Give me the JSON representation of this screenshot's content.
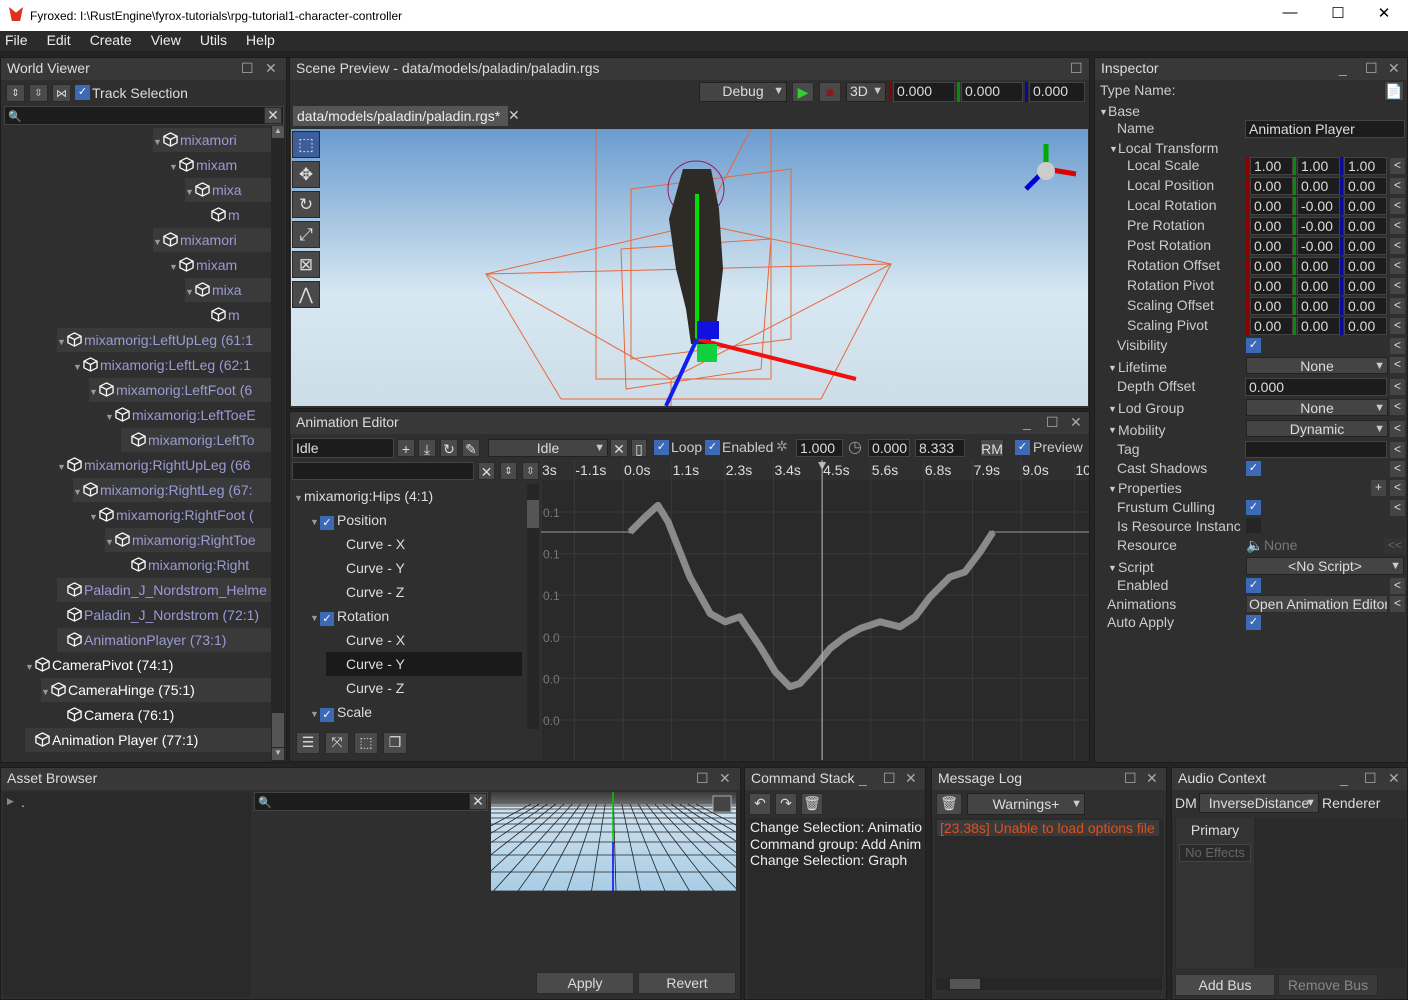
{
  "window": {
    "title": "Fyroxed: I:\\RustEngine\\fyrox-tutorials\\rpg-tutorial1-character-controller",
    "minimize": "—",
    "maximize": "☐",
    "close": "✕"
  },
  "menu": [
    "File",
    "Edit",
    "Create",
    "View",
    "Utils",
    "Help"
  ],
  "world_viewer": {
    "title": "World Viewer",
    "track_selection": "Track Selection",
    "search_placeholder": "",
    "items": [
      {
        "text": "mixamori",
        "level": 9,
        "tri": true,
        "shade": true,
        "color": "#9b9bd6"
      },
      {
        "text": "mixam",
        "level": 10,
        "tri": true,
        "shade": false,
        "color": "#9b9bd6"
      },
      {
        "text": "mixa",
        "level": 11,
        "tri": true,
        "shade": true,
        "color": "#9b9bd6"
      },
      {
        "text": "m",
        "level": 12,
        "tri": false,
        "shade": false,
        "color": "#9b9bd6"
      },
      {
        "text": "mixamori",
        "level": 9,
        "tri": true,
        "shade": true,
        "color": "#9b9bd6"
      },
      {
        "text": "mixam",
        "level": 10,
        "tri": true,
        "shade": false,
        "color": "#9b9bd6"
      },
      {
        "text": "mixa",
        "level": 11,
        "tri": true,
        "shade": true,
        "color": "#9b9bd6"
      },
      {
        "text": "m",
        "level": 12,
        "tri": false,
        "shade": false,
        "color": "#9b9bd6"
      },
      {
        "text": "mixamorig:LeftUpLeg (61:1",
        "level": 3,
        "tri": true,
        "shade": true,
        "color": "#9b9bd6"
      },
      {
        "text": "mixamorig:LeftLeg (62:1",
        "level": 4,
        "tri": true,
        "shade": false,
        "color": "#9b9bd6"
      },
      {
        "text": "mixamorig:LeftFoot (6",
        "level": 5,
        "tri": true,
        "shade": true,
        "color": "#9b9bd6"
      },
      {
        "text": "mixamorig:LeftToeE",
        "level": 6,
        "tri": true,
        "shade": false,
        "color": "#9b9bd6"
      },
      {
        "text": "mixamorig:LeftTo",
        "level": 7,
        "tri": false,
        "shade": true,
        "color": "#9b9bd6"
      },
      {
        "text": "mixamorig:RightUpLeg (66",
        "level": 3,
        "tri": true,
        "shade": false,
        "color": "#9b9bd6"
      },
      {
        "text": "mixamorig:RightLeg (67:",
        "level": 4,
        "tri": true,
        "shade": true,
        "color": "#9b9bd6"
      },
      {
        "text": "mixamorig:RightFoot (",
        "level": 5,
        "tri": true,
        "shade": false,
        "color": "#9b9bd6"
      },
      {
        "text": "mixamorig:RightToe",
        "level": 6,
        "tri": true,
        "shade": true,
        "color": "#9b9bd6"
      },
      {
        "text": "mixamorig:Right",
        "level": 7,
        "tri": false,
        "shade": false,
        "color": "#9b9bd6"
      },
      {
        "text": "Paladin_J_Nordstrom_Helme",
        "level": 3,
        "tri": false,
        "shade": true,
        "color": "#9b9bd6"
      },
      {
        "text": "Paladin_J_Nordstrom (72:1)",
        "level": 3,
        "tri": false,
        "shade": false,
        "color": "#9b9bd6"
      },
      {
        "text": "AnimationPlayer (73:1)",
        "level": 3,
        "tri": false,
        "shade": true,
        "color": "#9b9bd6"
      },
      {
        "text": "CameraPivot (74:1)",
        "level": 1,
        "tri": true,
        "shade": false,
        "color": "#ffffff"
      },
      {
        "text": "CameraHinge (75:1)",
        "level": 2,
        "tri": true,
        "shade": true,
        "color": "#ffffff"
      },
      {
        "text": "Camera (76:1)",
        "level": 3,
        "tri": false,
        "shade": false,
        "color": "#ffffff"
      },
      {
        "text": "Animation Player (77:1)",
        "level": 1,
        "tri": false,
        "shade": true,
        "color": "#ffffff"
      }
    ]
  },
  "scene_preview": {
    "title": "Scene Preview - data/models/paladin/paladin.rgs",
    "mode": "Debug",
    "view": "3D",
    "x": "0.000",
    "y": "0.000",
    "z": "0.000",
    "tab": "data/models/paladin/paladin.rgs*",
    "tools": [
      "select",
      "move",
      "rotate",
      "scale",
      "resize",
      "navmesh"
    ]
  },
  "animation_editor": {
    "title": "Animation Editor",
    "animation_name": "Idle",
    "selected_animation": "Idle",
    "loop": "Loop",
    "enabled": "Enabled",
    "speed": "1.000",
    "time_start": "0.000",
    "time_end": "8.333",
    "rm": "RM",
    "preview": "Preview",
    "tracks": [
      {
        "text": "mixamorig:Hips (4:1)",
        "level": 0,
        "tri": true,
        "check": false
      },
      {
        "text": "Position",
        "level": 1,
        "tri": true,
        "check": true
      },
      {
        "text": "Curve - X",
        "level": 2,
        "tri": false,
        "check": false
      },
      {
        "text": "Curve - Y",
        "level": 2,
        "tri": false,
        "check": false
      },
      {
        "text": "Curve - Z",
        "level": 2,
        "tri": false,
        "check": false
      },
      {
        "text": "Rotation",
        "level": 1,
        "tri": true,
        "check": true
      },
      {
        "text": "Curve - X",
        "level": 2,
        "tri": false,
        "check": false
      },
      {
        "text": "Curve - Y",
        "level": 2,
        "tri": false,
        "check": false,
        "selected": true
      },
      {
        "text": "Curve - Z",
        "level": 2,
        "tri": false,
        "check": false
      },
      {
        "text": "Scale",
        "level": 1,
        "tri": true,
        "check": true
      }
    ]
  },
  "chart_data": {
    "type": "line",
    "x_ticks": [
      "3s",
      "-1.1s",
      "0.0s",
      "1.1s",
      "2.3s",
      "3.4s",
      "4.5s",
      "5.6s",
      "6.8s",
      "7.9s",
      "9.0s",
      "10"
    ],
    "y_ticks": [
      "0.1",
      "0.1",
      "0.1",
      "0.0",
      "0.0",
      "0.0"
    ],
    "playhead_time": 4.5,
    "grid": true,
    "curve_color": "#8a8a8a",
    "points": [
      [
        0.16,
        0.113
      ],
      [
        0.5,
        0.122
      ],
      [
        0.79,
        0.129
      ],
      [
        1.02,
        0.119
      ],
      [
        1.51,
        0.086
      ],
      [
        1.97,
        0.064
      ],
      [
        2.31,
        0.059
      ],
      [
        2.64,
        0.062
      ],
      [
        3.1,
        0.044
      ],
      [
        3.44,
        0.029
      ],
      [
        3.77,
        0.02
      ],
      [
        4.0,
        0.022
      ],
      [
        4.34,
        0.032
      ],
      [
        4.68,
        0.043
      ],
      [
        5.02,
        0.05
      ],
      [
        5.36,
        0.055
      ],
      [
        5.81,
        0.059
      ],
      [
        6.26,
        0.056
      ],
      [
        6.6,
        0.062
      ],
      [
        6.94,
        0.074
      ],
      [
        7.39,
        0.086
      ],
      [
        7.73,
        0.089
      ],
      [
        8.07,
        0.101
      ],
      [
        8.36,
        0.113
      ]
    ]
  },
  "inspector": {
    "title": "Inspector",
    "type_name": "Type Name:",
    "base": "Base",
    "name_label": "Name",
    "name_value": "Animation Player",
    "local_transform": "Local Transform",
    "vectors": [
      {
        "label": "Local Scale",
        "v": [
          "1.00",
          "1.00",
          "1.00"
        ]
      },
      {
        "label": "Local Position",
        "v": [
          "0.00",
          "0.00",
          "0.00"
        ]
      },
      {
        "label": "Local Rotation",
        "v": [
          "0.00",
          "-0.00",
          "0.00"
        ]
      },
      {
        "label": "Pre Rotation",
        "v": [
          "0.00",
          "-0.00",
          "0.00"
        ]
      },
      {
        "label": "Post Rotation",
        "v": [
          "0.00",
          "-0.00",
          "0.00"
        ]
      },
      {
        "label": "Rotation Offset",
        "v": [
          "0.00",
          "0.00",
          "0.00"
        ]
      },
      {
        "label": "Rotation Pivot",
        "v": [
          "0.00",
          "0.00",
          "0.00"
        ]
      },
      {
        "label": "Scaling Offset",
        "v": [
          "0.00",
          "0.00",
          "0.00"
        ]
      },
      {
        "label": "Scaling Pivot",
        "v": [
          "0.00",
          "0.00",
          "0.00"
        ]
      }
    ],
    "visibility": "Visibility",
    "lifetime": "Lifetime",
    "lifetime_value": "None",
    "depth_offset": "Depth Offset",
    "depth_value": "0.000",
    "lod_group": "Lod Group",
    "lod_value": "None",
    "mobility": "Mobility",
    "mobility_value": "Dynamic",
    "tag": "Tag",
    "tag_value": "",
    "cast_shadows": "Cast Shadows",
    "properties": "Properties",
    "frustum_culling": "Frustum Culling",
    "is_resource_instance": "Is Resource Instanc",
    "resource": "Resource",
    "resource_value": "None",
    "script": "Script",
    "script_value": "<No Script>",
    "enabled": "Enabled",
    "animations": "Animations",
    "animations_button": "Open Animation Editor",
    "auto_apply": "Auto Apply",
    "revert": "<",
    "revert_all": "<<",
    "add": "+"
  },
  "asset_browser": {
    "title": "Asset Browser",
    "root": ".",
    "apply": "Apply",
    "revert": "Revert"
  },
  "command_stack": {
    "title": "Command Stack",
    "items": [
      "Change Selection: Animatio",
      "Command group: Add Anim",
      "Change Selection: Graph"
    ]
  },
  "message_log": {
    "title": "Message Log",
    "filter": "Warnings+",
    "messages": [
      "[23.38s] Unable to load options file ."
    ],
    "error_color": "#e0501e"
  },
  "audio_context": {
    "title": "Audio Context",
    "dm_label": "DM",
    "dm_value": "InverseDistance",
    "renderer_label": "Renderer",
    "bus": "Primary",
    "effects": "No Effects",
    "add_bus": "Add Bus",
    "remove_bus": "Remove Bus"
  }
}
